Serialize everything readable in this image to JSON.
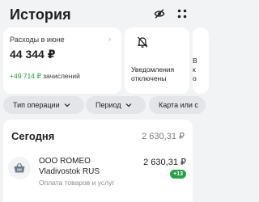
{
  "header": {
    "title": "История",
    "icons": [
      "eye-off-icon",
      "grid-icon"
    ]
  },
  "cards": {
    "spending": {
      "label": "Расходы в июне",
      "amount": "44 344 ₽",
      "income_amount": "+49 714 ₽",
      "income_label": "зачислений"
    },
    "notifications": {
      "icon": "bell-off-icon",
      "line1": "Уведомления",
      "line2": "отключены"
    },
    "peek": {
      "line1": "В",
      "line2": "к",
      "line3": "о"
    }
  },
  "filters": {
    "operation_type": "Тип операции",
    "period": "Период",
    "card": "Карта или с"
  },
  "list": {
    "day_title": "Сегодня",
    "day_total": "2 630,31 ₽",
    "transactions": [
      {
        "name_line1": "ООО ROMEO",
        "name_line2": "Vladivostok RUS",
        "category": "Оплата товаров и услуг",
        "amount": "2 630,31 ₽",
        "cashback": "+13",
        "icon": "shopping-basket-icon"
      }
    ]
  },
  "colors": {
    "background": "#f2f3f5",
    "card": "#ffffff",
    "accent_green": "#1f9d3e",
    "chip": "#e4e5e8"
  }
}
